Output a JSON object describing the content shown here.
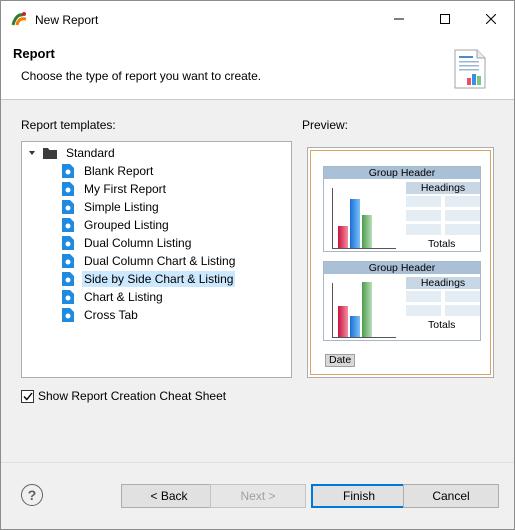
{
  "window": {
    "title": "New Report"
  },
  "banner": {
    "title": "Report",
    "description": "Choose the type of report you want to create."
  },
  "templates": {
    "label": "Report templates:",
    "category": "Standard",
    "items": [
      "Blank Report",
      "My First Report",
      "Simple Listing",
      "Grouped Listing",
      "Dual Column Listing",
      "Dual Column Chart & Listing",
      "Side by Side Chart & Listing",
      "Chart & Listing",
      "Cross Tab"
    ],
    "selected": "Side by Side Chart & Listing"
  },
  "preview": {
    "label": "Preview:",
    "group_header": "Group Header",
    "headings": "Headings",
    "totals": "Totals",
    "date": "Date"
  },
  "cheat_sheet": {
    "label": "Show Report Creation Cheat Sheet",
    "checked": true
  },
  "buttons": {
    "back": "< Back",
    "next": "Next >",
    "finish": "Finish",
    "cancel": "Cancel",
    "help": "?"
  }
}
